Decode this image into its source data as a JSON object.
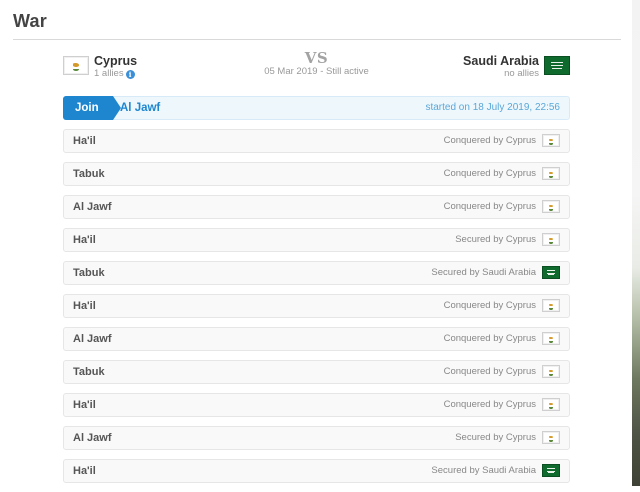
{
  "page": {
    "title": "War"
  },
  "war": {
    "attacker": {
      "name": "Cyprus",
      "allies": "1 allies",
      "flag_icon": "cyprus-flag-icon"
    },
    "defender": {
      "name": "Saudi Arabia",
      "allies": "no allies",
      "flag_icon": "saudi-arabia-flag-icon"
    },
    "vs_label": "VS",
    "meta": "05 Mar 2019 - Still active"
  },
  "battle": {
    "join_label": "Join",
    "region": "Al Jawf",
    "started": "started on 18 July 2019, 22:56"
  },
  "regions": [
    {
      "name": "Ha'il",
      "status": "Conquered by Cyprus",
      "flag": "cyprus"
    },
    {
      "name": "Tabuk",
      "status": "Conquered by Cyprus",
      "flag": "cyprus"
    },
    {
      "name": "Al Jawf",
      "status": "Conquered by Cyprus",
      "flag": "cyprus"
    },
    {
      "name": "Ha'il",
      "status": "Secured by Cyprus",
      "flag": "cyprus"
    },
    {
      "name": "Tabuk",
      "status": "Secured by Saudi Arabia",
      "flag": "saudi"
    },
    {
      "name": "Ha'il",
      "status": "Conquered by Cyprus",
      "flag": "cyprus"
    },
    {
      "name": "Al Jawf",
      "status": "Conquered by Cyprus",
      "flag": "cyprus"
    },
    {
      "name": "Tabuk",
      "status": "Conquered by Cyprus",
      "flag": "cyprus"
    },
    {
      "name": "Ha'il",
      "status": "Conquered by Cyprus",
      "flag": "cyprus"
    },
    {
      "name": "Al Jawf",
      "status": "Secured by Cyprus",
      "flag": "cyprus"
    },
    {
      "name": "Ha'il",
      "status": "Secured by Saudi Arabia",
      "flag": "saudi"
    }
  ],
  "colors": {
    "accent": "#1d86cf",
    "battle_bg": "#eef7fc",
    "saudi_green": "#0e6b2d"
  }
}
